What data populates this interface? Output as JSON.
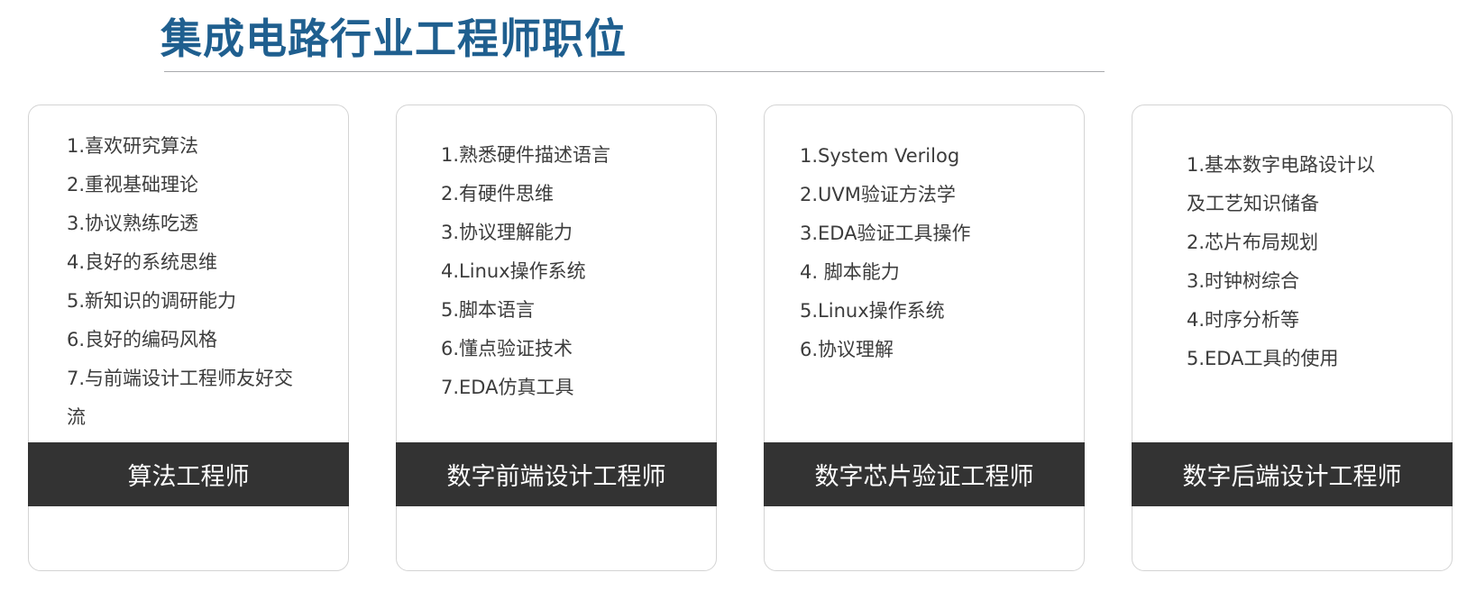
{
  "page": {
    "title": "集成电路行业工程师职位",
    "title_color": "#1f5f8f",
    "footer_color": "#333333"
  },
  "cards": [
    {
      "items": [
        "1.喜欢研究算法",
        "2.重视基础理论",
        "3.协议熟练吃透",
        "4.良好的系统思维",
        "5.新知识的调研能力",
        "6.良好的编码风格",
        "7.与前端设计工程师友好交流"
      ],
      "footer": "算法工程师"
    },
    {
      "items": [
        "1.熟悉硬件描述语言",
        "2.有硬件思维",
        "3.协议理解能力",
        "4.Linux操作系统",
        "5.脚本语言",
        "6.懂点验证技术",
        "7.EDA仿真工具"
      ],
      "footer": "数字前端设计工程师"
    },
    {
      "items": [
        "1.System Verilog",
        "2.UVM验证方法学",
        "3.EDA验证工具操作",
        "4. 脚本能力",
        "5.Linux操作系统",
        "6.协议理解"
      ],
      "footer": "数字芯片验证工程师"
    },
    {
      "items": [
        "1.基本数字电路设计以及工艺知识储备",
        "2.芯片布局规划",
        "3.时钟树综合",
        "4.时序分析等",
        "5.EDA工具的使用"
      ],
      "footer": "数字后端设计工程师"
    }
  ]
}
